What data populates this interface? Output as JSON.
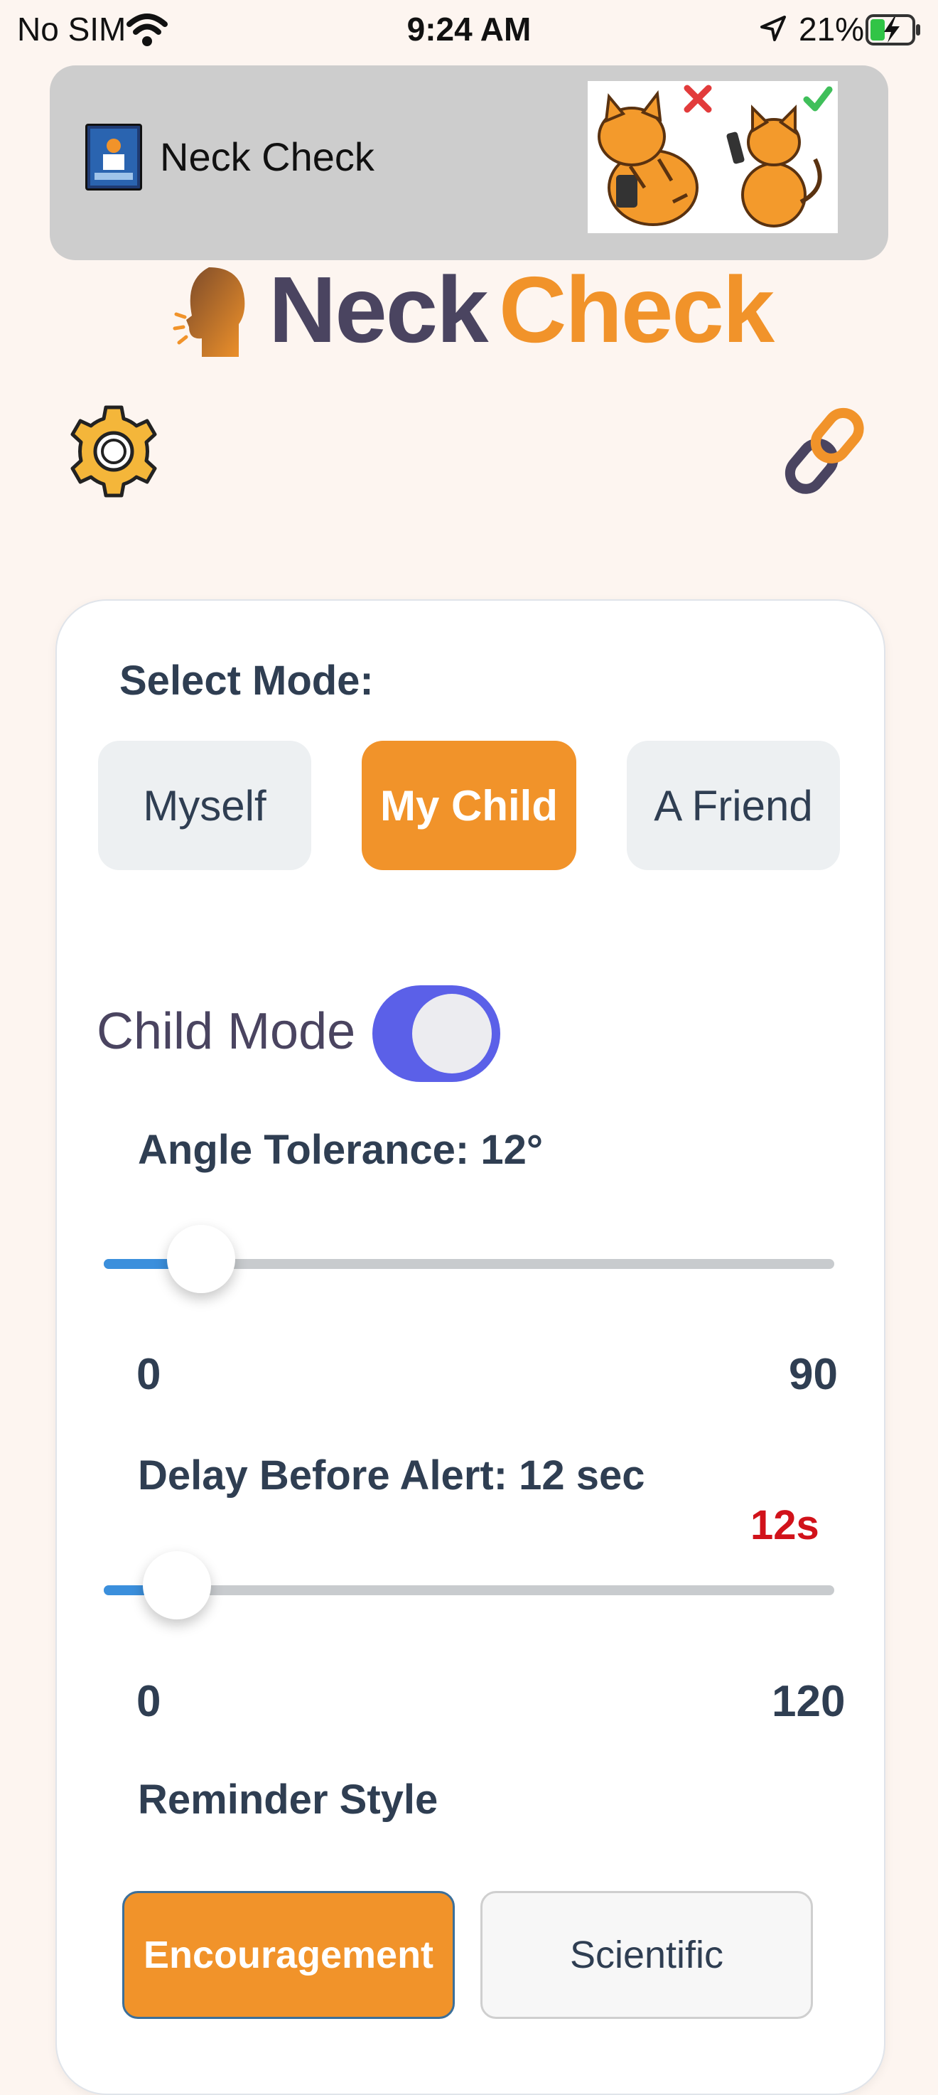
{
  "status_bar": {
    "carrier": "No SIM",
    "time": "9:24 AM",
    "battery_percent": "21%"
  },
  "banner": {
    "title": "Neck Check",
    "icon": "app-logo-icon",
    "image": "cats-phone-posture-illustration"
  },
  "logo": {
    "word_1": "Neck",
    "word_2": "Check",
    "icon": "head-profile-icon"
  },
  "toolbar": {
    "settings_icon": "gear-icon",
    "link_icon": "chain-link-icon"
  },
  "mode": {
    "label": "Select Mode:",
    "options": [
      "Myself",
      "My Child",
      "A Friend"
    ],
    "selected": "My Child"
  },
  "child_mode": {
    "label": "Child Mode",
    "enabled": true
  },
  "angle": {
    "label": "Angle Tolerance: 12°",
    "value": 12,
    "min_label": "0",
    "max_label": "90",
    "min": 0,
    "max": 90
  },
  "delay": {
    "label": "Delay Before Alert: 12 sec",
    "badge": "12s",
    "value": 12,
    "min_label": "0",
    "max_label": "120",
    "min": 0,
    "max": 120
  },
  "reminder": {
    "label": "Reminder Style",
    "options": [
      "Encouragement",
      "Scientific"
    ],
    "selected": "Encouragement"
  },
  "colors": {
    "accent_orange": "#f1932a",
    "toggle_purple": "#5b60e8",
    "slider_blue": "#3b8fdc",
    "badge_red": "#d1121a"
  }
}
